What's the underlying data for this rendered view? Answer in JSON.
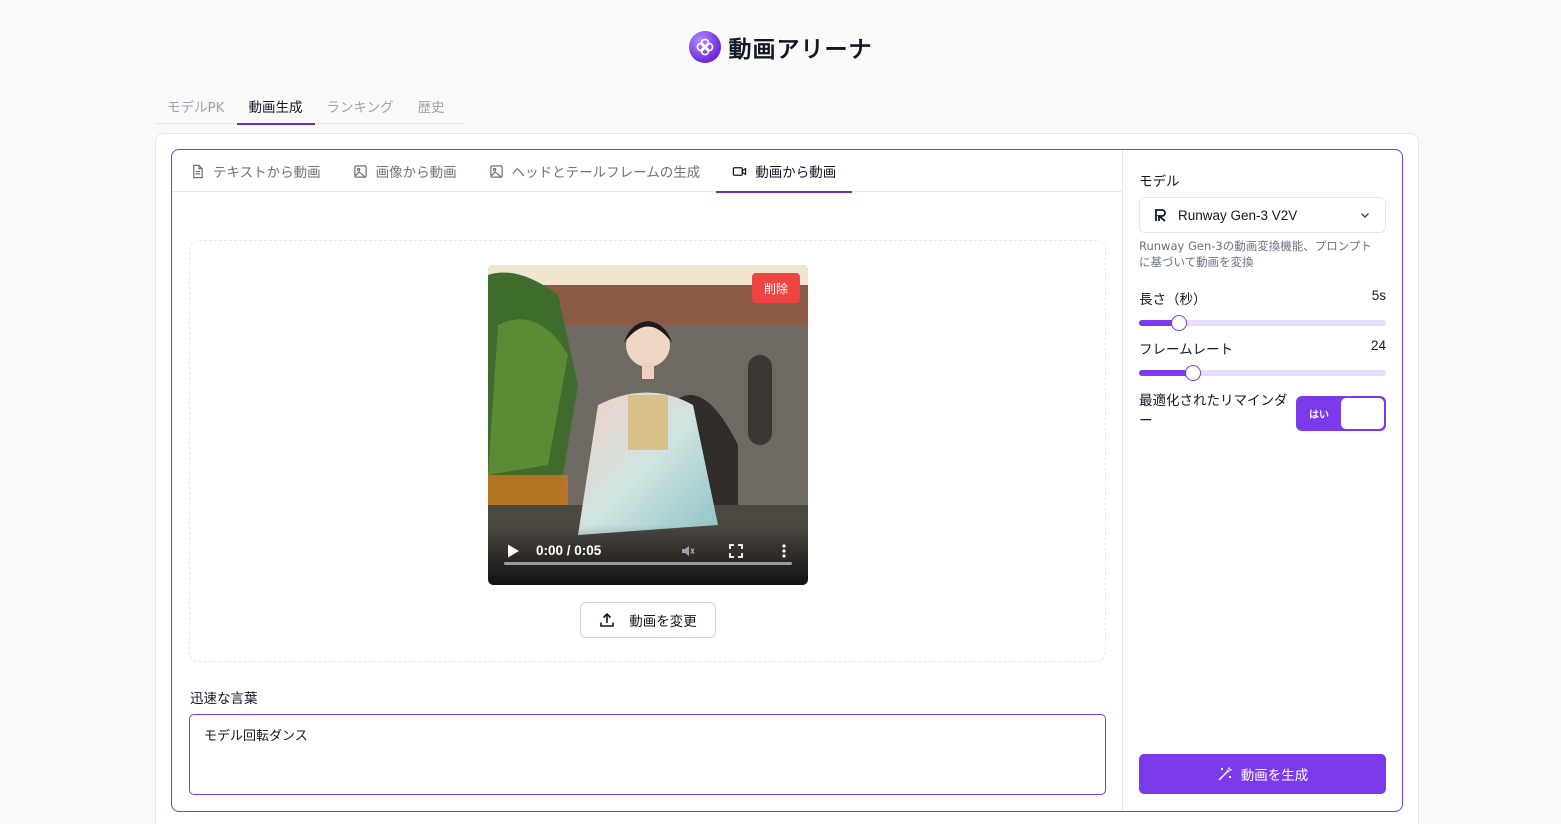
{
  "app": {
    "title": "動画アリーナ",
    "logo_icon": "flower-logo-icon"
  },
  "top_tabs": [
    {
      "label": "モデルPK",
      "active": false
    },
    {
      "label": "動画生成",
      "active": true
    },
    {
      "label": "ランキング",
      "active": false
    },
    {
      "label": "歴史",
      "active": false
    }
  ],
  "sub_tabs": [
    {
      "label": "テキストから動画",
      "icon": "document-icon",
      "active": false
    },
    {
      "label": "画像から動画",
      "icon": "image-icon",
      "active": false
    },
    {
      "label": "ヘッドとテールフレームの生成",
      "icon": "image-icon",
      "active": false
    },
    {
      "label": "動画から動画",
      "icon": "video-camera-icon",
      "active": true
    }
  ],
  "video": {
    "delete_label": "削除",
    "time": "0:00 / 0:05",
    "change_label": "動画を変更"
  },
  "prompt": {
    "label": "迅速な言葉",
    "value": "モデル回転ダンス"
  },
  "side": {
    "model_label": "モデル",
    "model_value": "Runway Gen-3 V2V",
    "model_desc": "Runway Gen-3の動画変換機能、プロンプトに基づいて動画を変換",
    "duration": {
      "label": "長さ（秒）",
      "value_text": "5s",
      "fraction": 0.16
    },
    "framerate": {
      "label": "フレームレート",
      "value_text": "24",
      "fraction": 0.22
    },
    "reminder_label": "最適化されたリマインダー",
    "toggle_text": "はい",
    "toggle_on": true,
    "generate_label": "動画を生成"
  },
  "colors": {
    "accent": "#7c3aed",
    "danger": "#ef4444"
  }
}
